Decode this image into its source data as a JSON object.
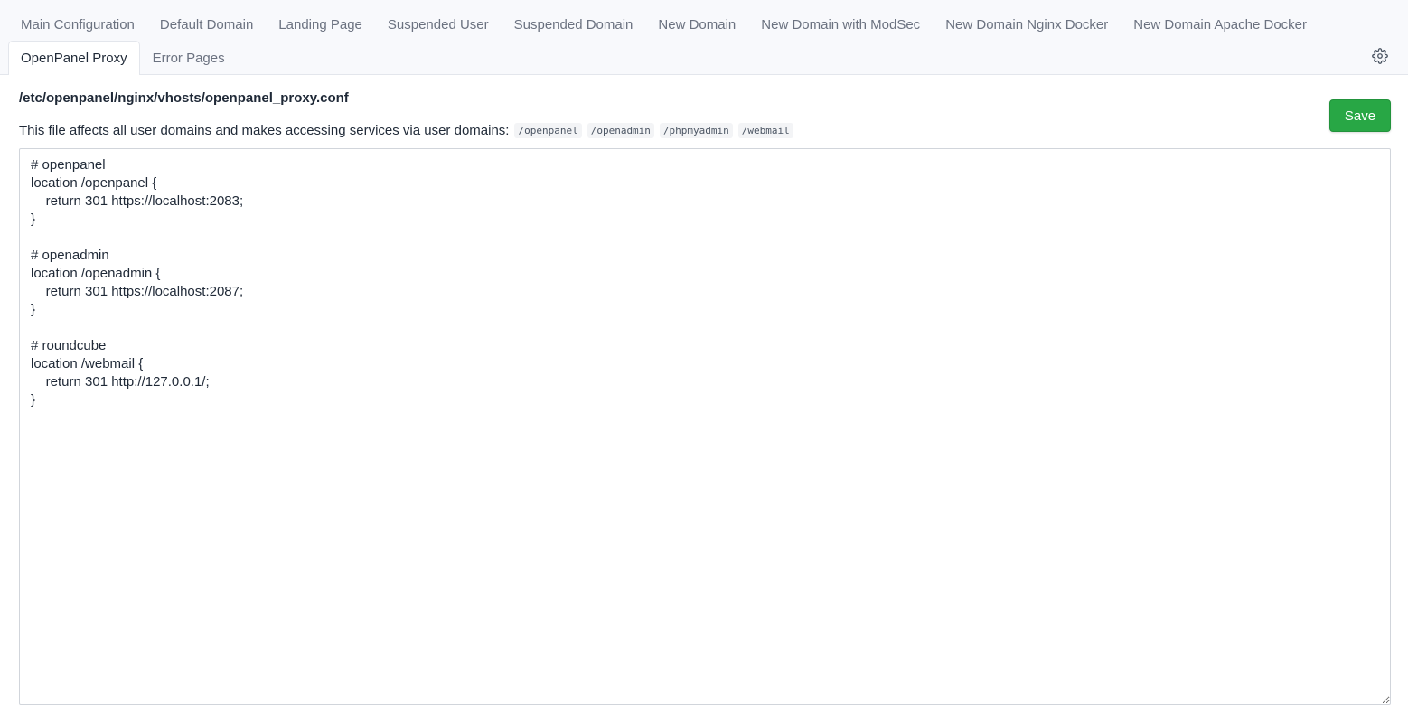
{
  "tabs": {
    "row1": [
      {
        "label": "Main Configuration"
      },
      {
        "label": "Default Domain"
      },
      {
        "label": "Landing Page"
      },
      {
        "label": "Suspended User"
      },
      {
        "label": "Suspended Domain"
      },
      {
        "label": "New Domain"
      },
      {
        "label": "New Domain with ModSec"
      },
      {
        "label": "New Domain Nginx Docker"
      },
      {
        "label": "New Domain Apache Docker"
      }
    ],
    "row2": [
      {
        "label": "OpenPanel Proxy",
        "active": true
      },
      {
        "label": "Error Pages"
      }
    ]
  },
  "settings_icon": "gear-icon",
  "file": {
    "path": "/etc/openpanel/nginx/vhosts/openpanel_proxy.conf",
    "description": "This file affects all user domains and makes accessing services via user domains:",
    "paths": [
      "/openpanel",
      "/openadmin",
      "/phpmyadmin",
      "/webmail"
    ],
    "content": "# openpanel\nlocation /openpanel {\n    return 301 https://localhost:2083;\n}\n\n# openadmin\nlocation /openadmin {\n    return 301 https://localhost:2087;\n}\n\n# roundcube\nlocation /webmail {\n    return 301 http://127.0.0.1/;\n}"
  },
  "actions": {
    "save_label": "Save"
  },
  "colors": {
    "save_button": "#28a745",
    "tabs_background": "#f8f9fc"
  }
}
